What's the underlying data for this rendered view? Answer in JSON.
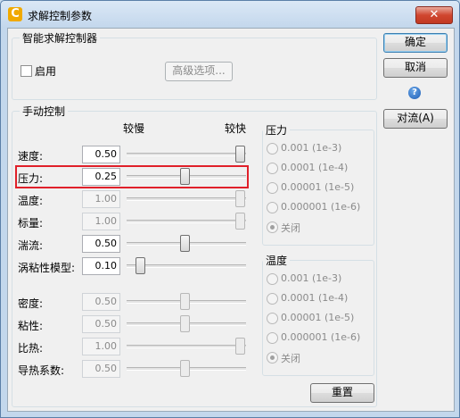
{
  "window": {
    "title": "求解控制参数",
    "close_glyph": "✕",
    "icon_glyph": "C"
  },
  "smart_solver": {
    "title": "智能求解控制器",
    "enable_label": "启用",
    "enabled": false,
    "advanced_button": "高级选项..."
  },
  "manual": {
    "title": "手动控制",
    "slow_label": "较慢",
    "fast_label": "较快",
    "rows": [
      {
        "label": "速度:",
        "value": "0.50",
        "enabled": true,
        "level": 1.0
      },
      {
        "label": "压力:",
        "value": "0.25",
        "enabled": true,
        "level": 0.5
      },
      {
        "label": "温度:",
        "value": "1.00",
        "enabled": false,
        "level": 1.0
      },
      {
        "label": "标量:",
        "value": "1.00",
        "enabled": false,
        "level": 1.0
      },
      {
        "label": "湍流:",
        "value": "0.50",
        "enabled": true,
        "level": 0.5
      },
      {
        "label": "涡粘性模型:",
        "value": "0.10",
        "enabled": true,
        "level": 0.1
      },
      {
        "label": "密度:",
        "value": "0.50",
        "enabled": false,
        "level": 0.5
      },
      {
        "label": "粘性:",
        "value": "0.50",
        "enabled": false,
        "level": 0.5
      },
      {
        "label": "比热:",
        "value": "1.00",
        "enabled": false,
        "level": 1.0
      },
      {
        "label": "导热系数:",
        "value": "0.50",
        "enabled": false,
        "level": 0.5
      }
    ]
  },
  "pressure_group": {
    "title": "压力",
    "options": [
      "0.001 (1e-3)",
      "0.0001 (1e-4)",
      "0.00001 (1e-5)",
      "0.000001 (1e-6)",
      "关闭"
    ],
    "selected": "关闭"
  },
  "temperature_group": {
    "title": "温度",
    "options": [
      "0.001 (1e-3)",
      "0.0001 (1e-4)",
      "0.00001 (1e-5)",
      "0.000001 (1e-6)",
      "关闭"
    ],
    "selected": "关闭"
  },
  "buttons": {
    "ok": "确定",
    "cancel": "取消",
    "help_glyph": "?",
    "convection": "对流(A)",
    "reset": "重置"
  },
  "colors": {
    "highlight": "#e0202a",
    "title_bar": "#c3d7ec",
    "client_bg": "#f0f0f0"
  }
}
